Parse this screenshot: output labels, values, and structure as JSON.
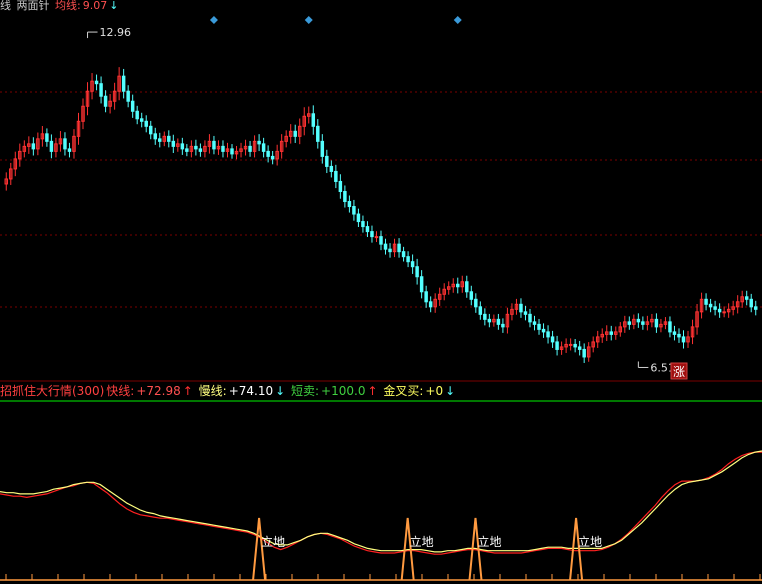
{
  "header": {
    "label_prefix": "线",
    "indicator": "两面针",
    "ma_label": "均线:",
    "ma_value": "9.07",
    "ma_arrow": "↓"
  },
  "price_panel": {
    "high_label": "12.96",
    "low_label": "6.51",
    "badge": "涨"
  },
  "indicator_panel": {
    "title": "招抓住大行情(300)",
    "fast_label": "快线:",
    "fast_value": "+72.98",
    "fast_arrow": "↑",
    "slow_label": "慢线:",
    "slow_value": "+74.10",
    "slow_arrow": "↓",
    "short_label": "短卖:",
    "short_value": "+100.0",
    "short_arrow": "↑",
    "cross_label": "金叉买:",
    "cross_value": "+0",
    "cross_arrow": "↓",
    "spike_label": "立地"
  },
  "colors": {
    "up": "#ff3232",
    "down": "#54ffff",
    "fast_line": "#ff2020",
    "slow_line": "#ffff80",
    "spike": "#ff9a40",
    "grid": "#7a0000",
    "separator": "#00a000",
    "diamond": "#3a9ad9",
    "ma_value": "#ff5050",
    "fast_value": "#ff5050",
    "slow_value": "#ffffff",
    "short_value": "#40d040",
    "cross_value": "#ffff60"
  },
  "chart_data": [
    {
      "type": "candlestick",
      "title": "",
      "ylim": [
        6.3,
        13.4
      ],
      "annotations": [
        {
          "text": "12.96",
          "value": 12.96,
          "index": 18
        },
        {
          "text": "6.51",
          "value": 6.51,
          "index": 140
        }
      ],
      "signal_markers_at": [
        46,
        67,
        100
      ],
      "close": [
        10.15,
        10.35,
        10.55,
        10.7,
        10.8,
        10.85,
        10.75,
        10.95,
        11.05,
        10.9,
        10.7,
        10.85,
        10.95,
        10.75,
        10.7,
        11.0,
        11.3,
        11.6,
        11.9,
        12.1,
        12.05,
        11.8,
        11.6,
        11.7,
        11.9,
        12.2,
        11.9,
        11.7,
        11.5,
        11.35,
        11.3,
        11.2,
        11.05,
        10.95,
        10.9,
        11.0,
        10.9,
        10.8,
        10.85,
        10.75,
        10.7,
        10.8,
        10.75,
        10.7,
        10.8,
        10.9,
        10.75,
        10.8,
        10.7,
        10.75,
        10.65,
        10.7,
        10.75,
        10.8,
        10.7,
        10.9,
        10.85,
        10.7,
        10.6,
        10.55,
        10.7,
        10.9,
        11.0,
        11.1,
        11.0,
        11.2,
        11.4,
        11.45,
        11.2,
        10.9,
        10.6,
        10.4,
        10.3,
        10.1,
        9.9,
        9.7,
        9.6,
        9.45,
        9.3,
        9.2,
        9.1,
        9.0,
        9.0,
        8.85,
        8.75,
        8.7,
        8.85,
        8.7,
        8.6,
        8.5,
        8.4,
        8.2,
        7.9,
        7.7,
        7.6,
        7.75,
        7.85,
        7.95,
        8.0,
        8.05,
        8.0,
        8.1,
        7.9,
        7.75,
        7.6,
        7.45,
        7.35,
        7.3,
        7.35,
        7.25,
        7.2,
        7.45,
        7.55,
        7.65,
        7.5,
        7.45,
        7.3,
        7.25,
        7.15,
        7.1,
        7.0,
        6.9,
        6.75,
        6.8,
        6.85,
        6.85,
        6.8,
        6.75,
        6.6,
        6.8,
        6.9,
        7.0,
        7.05,
        7.1,
        7.05,
        7.1,
        7.2,
        7.3,
        7.25,
        7.35,
        7.3,
        7.25,
        7.3,
        7.35,
        7.2,
        7.25,
        7.3,
        7.1,
        7.05,
        7.0,
        6.9,
        7.0,
        7.2,
        7.5,
        7.75,
        7.65,
        7.6,
        7.55,
        7.5,
        7.5,
        7.55,
        7.6,
        7.7,
        7.8,
        7.75,
        7.6,
        7.55
      ],
      "spread": [
        0.22,
        0.2,
        0.24,
        0.26,
        0.2,
        0.25,
        0.22,
        0.21,
        0.26,
        0.18,
        0.23,
        0.2,
        0.26,
        0.22,
        0.2,
        0.24,
        0.28,
        0.26,
        0.3,
        0.27,
        0.22,
        0.24,
        0.2,
        0.24,
        0.28,
        0.3,
        0.24,
        0.2,
        0.22,
        0.18,
        0.2,
        0.2,
        0.18,
        0.2,
        0.2,
        0.16,
        0.2,
        0.22,
        0.18,
        0.2,
        0.16,
        0.2,
        0.22,
        0.18,
        0.2,
        0.24,
        0.18,
        0.2,
        0.2,
        0.2,
        0.16,
        0.18,
        0.2,
        0.22,
        0.18,
        0.2,
        0.24,
        0.2,
        0.2,
        0.18,
        0.22,
        0.24,
        0.2,
        0.24,
        0.22,
        0.26,
        0.3,
        0.24,
        0.28,
        0.24,
        0.24,
        0.22,
        0.2,
        0.22,
        0.24,
        0.2,
        0.2,
        0.22,
        0.18,
        0.2,
        0.18,
        0.2,
        0.18,
        0.2,
        0.18,
        0.2,
        0.18,
        0.2,
        0.16,
        0.18,
        0.24,
        0.26,
        0.22,
        0.2,
        0.18,
        0.2,
        0.22,
        0.2,
        0.18,
        0.2,
        0.22,
        0.2,
        0.2,
        0.2,
        0.2,
        0.18,
        0.2,
        0.18,
        0.16,
        0.18,
        0.2,
        0.22,
        0.2,
        0.18,
        0.2,
        0.2,
        0.18,
        0.2,
        0.18,
        0.2,
        0.22,
        0.2,
        0.2,
        0.18,
        0.2,
        0.2,
        0.18,
        0.2,
        0.2,
        0.16,
        0.18,
        0.2,
        0.2,
        0.22,
        0.2,
        0.18,
        0.16,
        0.2,
        0.18,
        0.16,
        0.2,
        0.18,
        0.2,
        0.18,
        0.2,
        0.18,
        0.16,
        0.18,
        0.2,
        0.2,
        0.22,
        0.2,
        0.24,
        0.26,
        0.22,
        0.2,
        0.18,
        0.2,
        0.2,
        0.18,
        0.2,
        0.2,
        0.22,
        0.2,
        0.2,
        0.18,
        0.2,
        0.2
      ]
    },
    {
      "type": "line",
      "title": "招抓住大行情(300)",
      "ylim": [
        0,
        100
      ],
      "series": [
        {
          "name": "快线",
          "values": [
            57,
            56,
            55,
            55,
            54,
            55,
            56,
            57,
            59,
            61,
            63,
            64,
            66,
            67,
            66,
            62,
            58,
            53,
            48,
            44,
            41,
            39,
            38,
            37,
            36,
            36,
            35,
            34,
            33,
            32,
            31,
            30,
            29,
            28,
            27,
            26,
            25,
            24,
            22,
            19,
            15,
            11,
            9,
            11,
            14,
            17,
            20,
            22,
            23,
            22,
            20,
            18,
            15,
            12,
            10,
            8,
            7,
            6,
            6,
            6,
            7,
            8,
            8,
            7,
            6,
            5,
            5,
            6,
            7,
            8,
            9,
            9,
            8,
            7,
            6,
            6,
            6,
            6,
            6,
            7,
            8,
            9,
            10,
            10,
            10,
            9,
            8,
            8,
            8,
            8,
            9,
            11,
            14,
            18,
            23,
            29,
            35,
            41,
            47,
            54,
            60,
            65,
            68,
            68,
            68,
            69,
            71,
            74,
            78,
            83,
            87,
            90,
            92,
            93,
            93
          ]
        },
        {
          "name": "慢线",
          "values": [
            59,
            58,
            58,
            57,
            57,
            57,
            58,
            59,
            61,
            62,
            63,
            65,
            66,
            67,
            67,
            65,
            61,
            57,
            53,
            49,
            46,
            43,
            41,
            40,
            38,
            37,
            36,
            35,
            34,
            33,
            32,
            31,
            30,
            29,
            28,
            27,
            26,
            25,
            23,
            20,
            17,
            14,
            13,
            13,
            15,
            17,
            20,
            22,
            23,
            23,
            21,
            19,
            17,
            14,
            12,
            10,
            9,
            8,
            8,
            8,
            8,
            9,
            9,
            9,
            8,
            7,
            7,
            8,
            8,
            9,
            10,
            10,
            9,
            8,
            8,
            8,
            8,
            8,
            8,
            8,
            9,
            10,
            11,
            11,
            11,
            10,
            10,
            10,
            10,
            10,
            10,
            12,
            14,
            17,
            22,
            27,
            32,
            38,
            44,
            50,
            56,
            61,
            65,
            67,
            68,
            69,
            70,
            73,
            76,
            80,
            84,
            88,
            91,
            93,
            94
          ]
        }
      ],
      "spikes_at_fraction": [
        0.34,
        0.535,
        0.624,
        0.756
      ],
      "spike_height": 100
    }
  ]
}
